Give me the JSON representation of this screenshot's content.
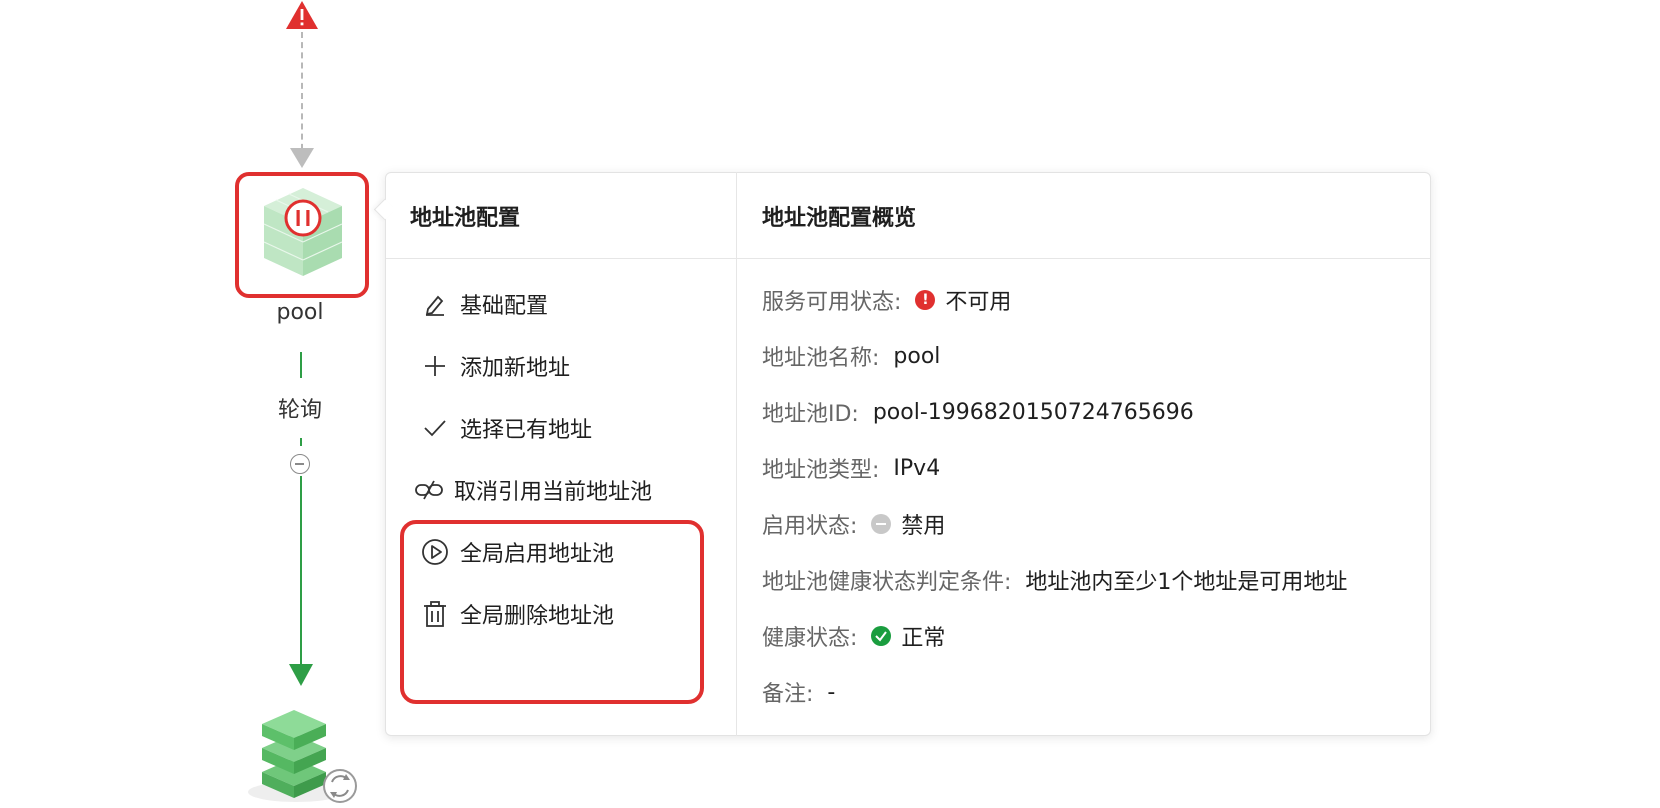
{
  "colors": {
    "alert_red": "#e0302f",
    "flow_green": "#2e9e46",
    "muted_gray": "#bdbdbd"
  },
  "flow": {
    "node_label": "pool",
    "algorithm_label": "轮询",
    "icons": [
      "alert-triangle-icon",
      "pool-paused-icon",
      "minus-circle-icon",
      "server-stack-icon",
      "refresh-badge-icon"
    ]
  },
  "panel": {
    "left_title": "地址池配置",
    "right_title": "地址池配置概览",
    "menu": [
      {
        "icon": "edit-icon",
        "label": "基础配置"
      },
      {
        "icon": "plus-icon",
        "label": "添加新地址"
      },
      {
        "icon": "check-icon",
        "label": "选择已有地址"
      },
      {
        "icon": "unlink-icon",
        "label": "取消引用当前地址池"
      },
      {
        "icon": "play-circle-icon",
        "label": "全局启用地址池"
      },
      {
        "icon": "trash-icon",
        "label": "全局删除地址池"
      }
    ],
    "overview": [
      {
        "key": "服务可用状态:",
        "value": "不可用",
        "status_icon": "error-icon",
        "status_color": "#e0302f"
      },
      {
        "key": "地址池名称:",
        "value": "pool"
      },
      {
        "key": "地址池ID:",
        "value": "pool-1996820150724765696"
      },
      {
        "key": "地址池类型:",
        "value": "IPv4"
      },
      {
        "key": "启用状态:",
        "value": "禁用",
        "status_icon": "disabled-icon",
        "status_color": "#c8c8c8"
      },
      {
        "key": "地址池健康状态判定条件:",
        "value": "地址池内至少1个地址是可用地址"
      },
      {
        "key": "健康状态:",
        "value": "正常",
        "status_icon": "success-icon",
        "status_color": "#1a9d3f"
      },
      {
        "key": "备注:",
        "value": "-"
      }
    ]
  }
}
